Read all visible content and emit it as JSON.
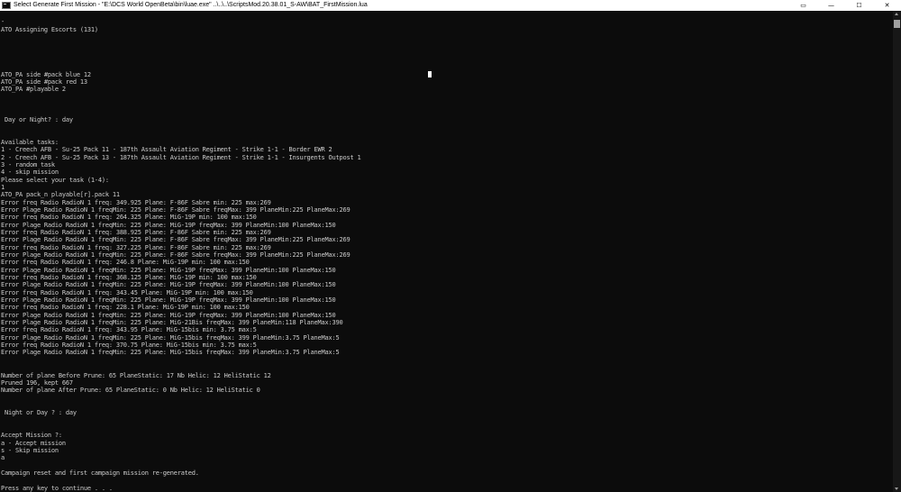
{
  "window": {
    "title": "Select Generate First Mission - \"E:\\DCS World OpenBeta\\bin\\luae.exe\"  ..\\..\\..\\ScriptsMod.20.38.01_S-AW\\BAT_FirstMission.lua",
    "icon": "console-app-icon",
    "controls": {
      "snap_glyph": "▭",
      "minimize_glyph": "—",
      "maximize_glyph": "☐",
      "close_glyph": "✕"
    }
  },
  "console": {
    "lines": [
      "",
      "-",
      "ATO Assigning Escorts (131)",
      "",
      "",
      "",
      "",
      "",
      "ATO_PA side #pack blue 12",
      "ATO_PA side #pack red 13",
      "ATO_PA #playable 2",
      "",
      "",
      "",
      " Day or Night? : day",
      "",
      "",
      "Available tasks:",
      "1 - Creech AFB - Su-25 Pack 11 - 187th Assault Aviation Regiment - Strike 1-1 - Border EWR 2",
      "2 - Creech AFB - Su-25 Pack 13 - 187th Assault Aviation Regiment - Strike 1-1 - Insurgents Outpost 1",
      "3 - random task",
      "4 - skip mission",
      "Please select your task (1-4):",
      "1",
      "ATO_PA pack_n playable[r].pack 11",
      "Error freq Radio RadioN 1 freq: 349.925 Plane: F-86F Sabre min: 225 max:269",
      "Error Plage Radio RadioN 1 freqMin: 225 Plane: F-86F Sabre freqMax: 399 PlaneMin:225 PlaneMax:269",
      "Error freq Radio RadioN 1 freq: 264.325 Plane: MiG-19P min: 100 max:150",
      "Error Plage Radio RadioN 1 freqMin: 225 Plane: MiG-19P freqMax: 399 PlaneMin:100 PlaneMax:150",
      "Error freq Radio RadioN 1 freq: 388.925 Plane: F-86F Sabre min: 225 max:269",
      "Error Plage Radio RadioN 1 freqMin: 225 Plane: F-86F Sabre freqMax: 399 PlaneMin:225 PlaneMax:269",
      "Error freq Radio RadioN 1 freq: 327.225 Plane: F-86F Sabre min: 225 max:269",
      "Error Plage Radio RadioN 1 freqMin: 225 Plane: F-86F Sabre freqMax: 399 PlaneMin:225 PlaneMax:269",
      "Error freq Radio RadioN 1 freq: 246.8 Plane: MiG-19P min: 100 max:150",
      "Error Plage Radio RadioN 1 freqMin: 225 Plane: MiG-19P freqMax: 399 PlaneMin:100 PlaneMax:150",
      "Error freq Radio RadioN 1 freq: 368.125 Plane: MiG-19P min: 100 max:150",
      "Error Plage Radio RadioN 1 freqMin: 225 Plane: MiG-19P freqMax: 399 PlaneMin:100 PlaneMax:150",
      "Error freq Radio RadioN 1 freq: 343.45 Plane: MiG-19P min: 100 max:150",
      "Error Plage Radio RadioN 1 freqMin: 225 Plane: MiG-19P freqMax: 399 PlaneMin:100 PlaneMax:150",
      "Error freq Radio RadioN 1 freq: 228.1 Plane: MiG-19P min: 100 max:150",
      "Error Plage Radio RadioN 1 freqMin: 225 Plane: MiG-19P freqMax: 399 PlaneMin:100 PlaneMax:150",
      "Error Plage Radio RadioN 1 freqMin: 225 Plane: MiG-21Bis freqMax: 399 PlaneMin:118 PlaneMax:390",
      "Error freq Radio RadioN 1 freq: 343.95 Plane: MiG-15bis min: 3.75 max:5",
      "Error Plage Radio RadioN 1 freqMin: 225 Plane: MiG-15bis freqMax: 399 PlaneMin:3.75 PlaneMax:5",
      "Error freq Radio RadioN 1 freq: 370.75 Plane: MiG-15bis min: 3.75 max:5",
      "Error Plage Radio RadioN 1 freqMin: 225 Plane: MiG-15bis freqMax: 399 PlaneMin:3.75 PlaneMax:5",
      "",
      "",
      "Number of plane Before Prune: 65 PlaneStatic: 17 Nb Helic: 12 HeliStatic 12",
      "Pruned 196, kept 667",
      "Number of plane After Prune: 65 PlaneStatic: 0 Nb Helic: 12 HeliStatic 0",
      "",
      "",
      " Night or Day ? : day",
      "",
      "",
      "Accept Mission ?:",
      "a - Accept mission",
      "s - Skip mission",
      "a",
      "",
      "Campaign reset and first campaign mission re-generated.",
      "",
      "Press any key to continue . . ."
    ]
  },
  "colors": {
    "background": "#0c0c0c",
    "text": "#cccccc",
    "titlebar": "#ffffff"
  }
}
